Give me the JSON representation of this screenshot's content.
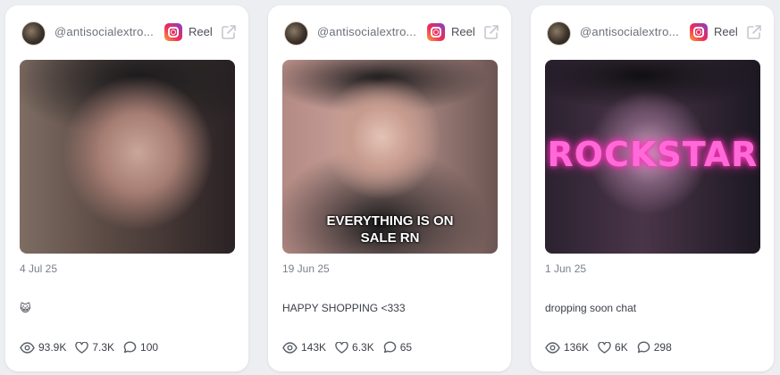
{
  "cards": [
    {
      "handle": "@antisocialextro...",
      "platform_icon": "instagram-icon",
      "type": "Reel",
      "overlay_text": "",
      "date": "4 Jul 25",
      "caption": "😺",
      "views": "93.9K",
      "likes": "7.3K",
      "comments": "100"
    },
    {
      "handle": "@antisocialextro...",
      "platform_icon": "instagram-icon",
      "type": "Reel",
      "overlay_text": "EVERYTHING IS ON SALE RN",
      "date": "19 Jun 25",
      "caption": "HAPPY SHOPPING <333",
      "views": "143K",
      "likes": "6.3K",
      "comments": "65"
    },
    {
      "handle": "@antisocialextro...",
      "platform_icon": "instagram-icon",
      "type": "Reel",
      "overlay_text": "ROCKSTAR",
      "date": "1 Jun 25",
      "caption": "dropping soon chat",
      "views": "136K",
      "likes": "6K",
      "comments": "298"
    }
  ],
  "colors": {
    "background": "#eceef2",
    "card": "#ffffff",
    "muted_text": "#7a8088",
    "body_text": "#3c4048"
  }
}
